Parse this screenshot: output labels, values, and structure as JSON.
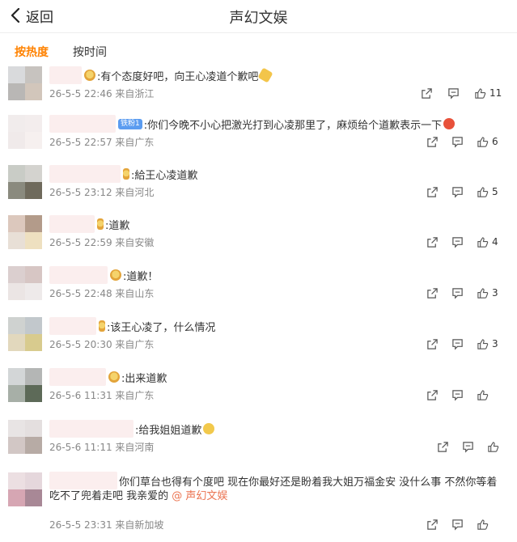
{
  "header": {
    "back_label": "返回",
    "title": "声幻文娱"
  },
  "tabs": [
    {
      "label": "按热度",
      "active": true
    },
    {
      "label": "按时间",
      "active": false
    }
  ],
  "colors": {
    "accent": "#ff8200",
    "mention": "#eb7350",
    "meta": "#888888"
  },
  "comments": [
    {
      "text": ":有个态度好吧，向王心凌道个歉吧",
      "meta": "26-5-5 22:46 来自浙江",
      "likes": "11",
      "badge": true,
      "tag": "",
      "emoji": "party-icon"
    },
    {
      "text": ":你们今晚不小心把激光打到心凌那里了，麻烦给个道歉表示一下",
      "meta": "26-5-5 22:57 来自广东",
      "likes": "6",
      "badge": false,
      "tag": "铁粉1",
      "emoji": "angry-face-icon"
    },
    {
      "text": ":給王心凌道歉",
      "meta": "26-5-5 23:12 来自河北",
      "likes": "5",
      "badge": true,
      "tag": "",
      "emoji": ""
    },
    {
      "text": ":道歉",
      "meta": "26-5-5 22:59 来自安徽",
      "likes": "4",
      "badge": true,
      "tag": "",
      "emoji": ""
    },
    {
      "text": ":道歉！",
      "meta": "26-5-5 22:48 来自山东",
      "likes": "3",
      "badge": true,
      "tag": "",
      "emoji": ""
    },
    {
      "text": ":该王心凌了，什么情况",
      "meta": "26-5-5 20:30 来自广东",
      "likes": "3",
      "badge": true,
      "tag": "",
      "emoji": ""
    },
    {
      "text": ":出来道歉",
      "meta": "26-5-6 11:31 来自广东",
      "likes": "",
      "badge": true,
      "tag": "",
      "emoji": ""
    },
    {
      "text": ":给我姐姐道歉",
      "meta": "26-5-6 11:11 来自河南",
      "likes": "",
      "badge": false,
      "tag": "",
      "emoji": "crying-face-icon"
    },
    {
      "text": "你们草台也得有个度吧 现在你最好还是盼着我大姐万福金安 没什么事 不然你等着",
      "text2": "吃不了兜着走吧 我亲爱的",
      "mention": "@ 声幻文娱",
      "meta": "26-5-5 23:31 来自新加坡",
      "likes": "",
      "badge": false,
      "tag": "",
      "emoji": ""
    }
  ]
}
